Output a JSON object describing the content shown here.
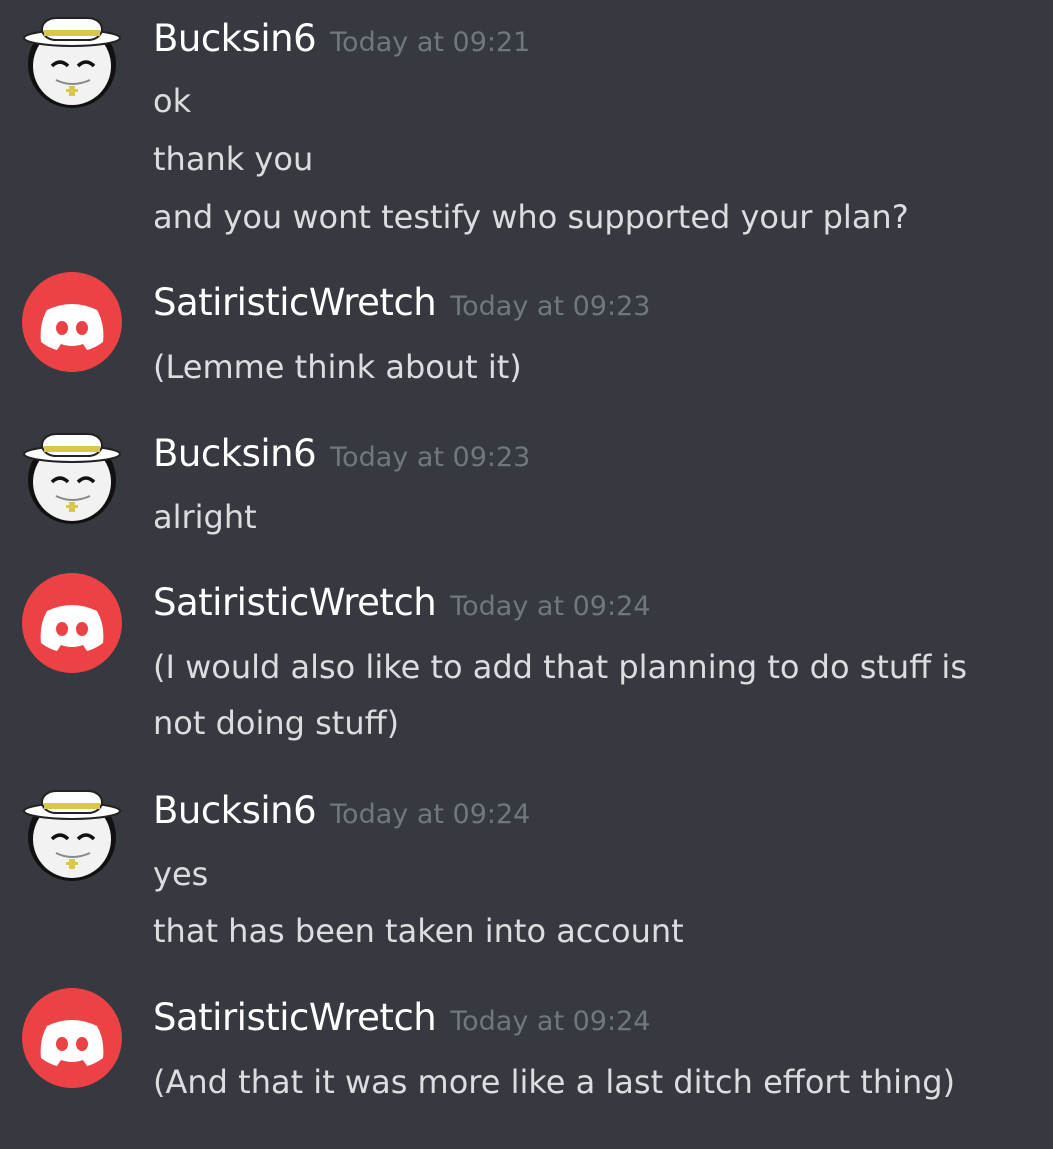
{
  "messages": [
    {
      "author": "Bucksin6",
      "avatar": "bucksin6-avatar-icon",
      "timestamp": "Today at 09:21",
      "lines": [
        "ok",
        "thank you",
        "and you wont testify who supported your plan?"
      ]
    },
    {
      "author": "SatiristicWretch",
      "avatar": "discord-default-avatar-icon",
      "timestamp": "Today at 09:23",
      "lines": [
        "(Lemme think about it)"
      ]
    },
    {
      "author": "Bucksin6",
      "avatar": "bucksin6-avatar-icon",
      "timestamp": "Today at 09:23",
      "lines": [
        "alright"
      ]
    },
    {
      "author": "SatiristicWretch",
      "avatar": "discord-default-avatar-icon",
      "timestamp": "Today at 09:24",
      "lines": [
        "(I would also like to add that planning to do stuff is",
        "not doing stuff)"
      ]
    },
    {
      "author": "Bucksin6",
      "avatar": "bucksin6-avatar-icon",
      "timestamp": "Today at 09:24",
      "lines": [
        "yes",
        "that has been taken into account"
      ]
    },
    {
      "author": "SatiristicWretch",
      "avatar": "discord-default-avatar-icon",
      "timestamp": "Today at 09:24",
      "lines": [
        "(And that it was more like a last ditch effort thing)"
      ]
    }
  ],
  "colors": {
    "background": "#36393f",
    "username": "#ffffff",
    "timestamp": "#72767d",
    "message_text": "#dcddde",
    "discord_red": "#ed4245"
  }
}
